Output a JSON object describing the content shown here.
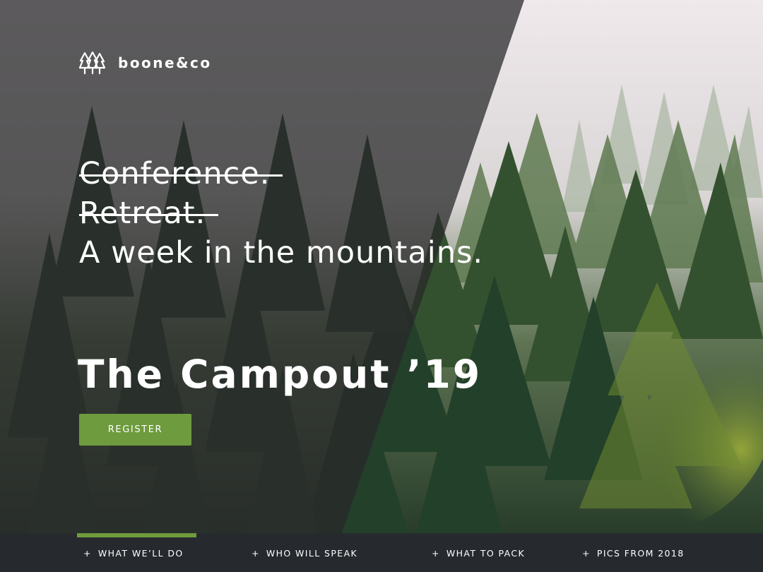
{
  "brand": {
    "name": "boone&co",
    "icon": "pine-trees-icon"
  },
  "headline": {
    "struck_lines": [
      "Conference.",
      "Retreat."
    ],
    "main_line": "A week in the mountains."
  },
  "event": {
    "title": "The Campout ’19"
  },
  "cta": {
    "register_label": "REGISTER"
  },
  "nav": {
    "bullet": "+",
    "items": [
      {
        "label": "WHAT WE’LL DO",
        "active": true
      },
      {
        "label": "WHO WILL SPEAK",
        "active": false
      },
      {
        "label": "WHAT TO PACK",
        "active": false
      },
      {
        "label": "PICS FROM 2018",
        "active": false
      }
    ]
  },
  "colors": {
    "accent": "#6e9b3d",
    "overlay": "#28282a",
    "nav_background": "#262a2e",
    "text": "#ffffff"
  }
}
